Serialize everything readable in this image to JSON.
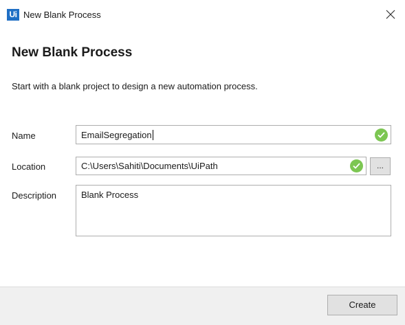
{
  "window": {
    "logo_text": "Ui",
    "title": "New Blank Process",
    "close_glyph": "close-icon"
  },
  "header": {
    "heading": "New Blank Process",
    "subtitle": "Start with a blank project to design a new automation process."
  },
  "form": {
    "name": {
      "label": "Name",
      "value": "EmailSegregation",
      "valid": true
    },
    "location": {
      "label": "Location",
      "value": "C:\\Users\\Sahiti\\Documents\\UiPath",
      "valid": true,
      "browse_label": "..."
    },
    "description": {
      "label": "Description",
      "value": "Blank Process"
    }
  },
  "footer": {
    "create_label": "Create"
  },
  "colors": {
    "accent": "#1f6fc5",
    "valid_check": "#7cc652",
    "button_bg": "#e1e1e1",
    "footer_bg": "#f0f0f0"
  }
}
